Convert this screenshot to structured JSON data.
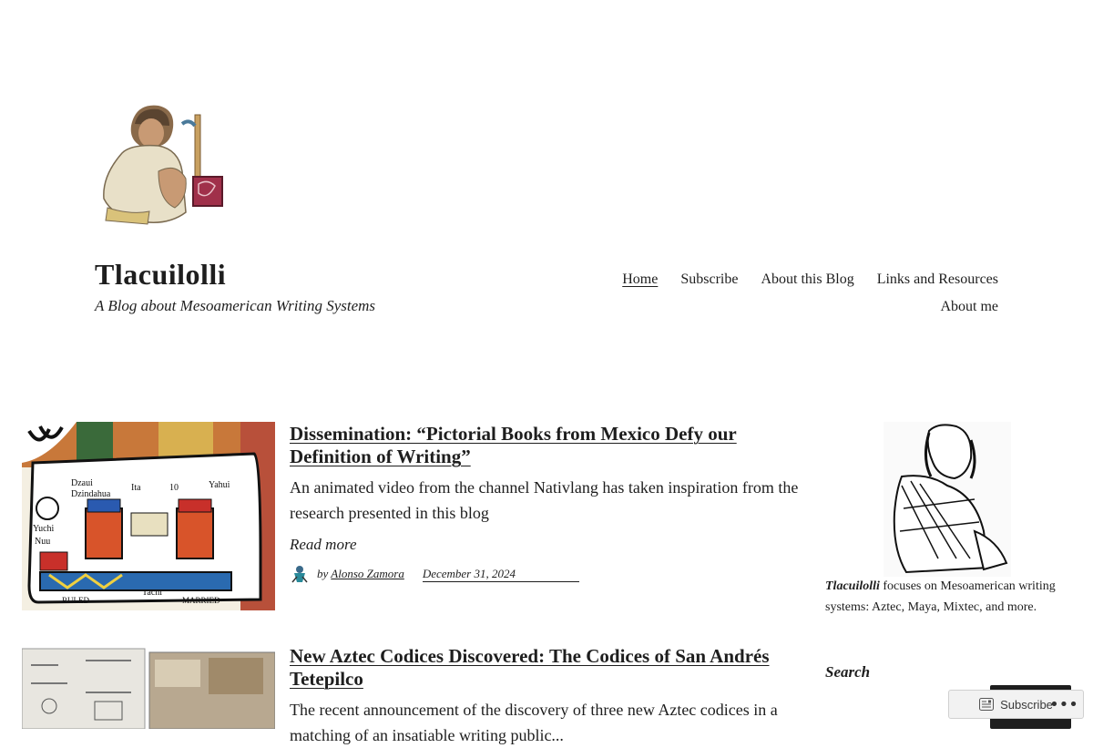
{
  "site": {
    "title": "Tlacuilolli",
    "tagline": "A Blog about Mesoamerican Writing Systems"
  },
  "nav": {
    "items": [
      "Home",
      "Subscribe",
      "About this Blog",
      "Links and Resources",
      "About me"
    ],
    "current": "Home"
  },
  "posts": [
    {
      "title": "Dissemination: “Pictorial Books from Mexico Defy our Definition of Writing”",
      "excerpt": "An animated video from the channel Nativlang has taken inspiration from the research presented in this blog",
      "read_more": "Read more",
      "by": "by",
      "author": "Alonso Zamora",
      "date": "December 31, 2024",
      "thumb_labels": [
        "Dzaui",
        "Dzindahua",
        "Ita",
        "10",
        "Yahui",
        "Yuchi",
        "Nuu",
        "Tachi",
        "RULED",
        "MARRIED"
      ]
    },
    {
      "title": "New Aztec Codices Discovered: The Codices of San Andrés Tetepilco",
      "excerpt": "The recent announcement of the discovery of three new Aztec codices in a matching of an insatiable writing public..."
    }
  ],
  "sidebar": {
    "about_name": "Tlacuilolli",
    "about_text": "focuses on Mesoamerican writing systems: Aztec, Maya, Mixtec, and more.",
    "search_label": "Search"
  },
  "subscribe_pill": {
    "label": "Subscribe"
  },
  "colors": {
    "text": "#1e1e1e",
    "background": "#ffffff",
    "button": "#1e1e1e"
  }
}
